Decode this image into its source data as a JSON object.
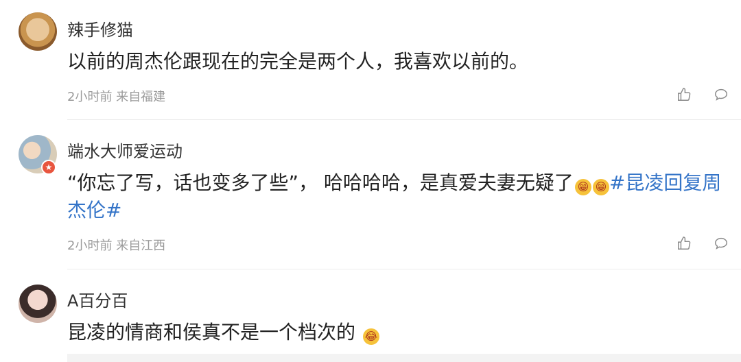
{
  "comments": [
    {
      "user": "辣手修猫",
      "text": "以前的周杰伦跟现在的完全是两个人，我喜欢以前的。",
      "meta": "2小时前 来自福建"
    },
    {
      "user": "端水大师爱运动",
      "text": "“你忘了写，话也变多了些”， 哈哈哈哈，是真爱夫妻无疑了",
      "emoji1": "😁",
      "emoji2": "😁",
      "topic_line1": "#昆凌回复周",
      "topic_line2": "杰伦#",
      "meta": "2小时前 来自江西"
    },
    {
      "user": "A百分百",
      "text": "昆凌的情商和侯真不是一个档次的",
      "emoji": "😂"
    }
  ],
  "icons": {
    "like": "thumbs-up-icon",
    "comment": "speech-bubble-icon",
    "verified": "verified-badge-icon"
  },
  "colors": {
    "topic": "#3474c8",
    "meta": "#9a9a9a",
    "verified": "#e8553e"
  }
}
